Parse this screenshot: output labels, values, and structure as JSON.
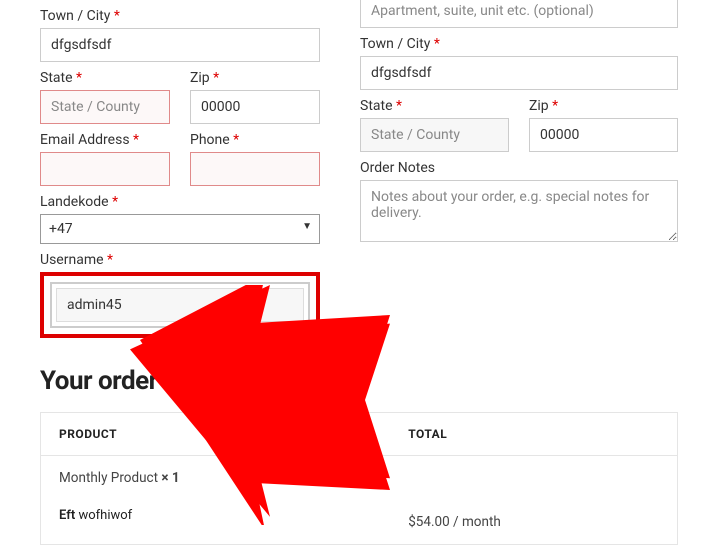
{
  "left": {
    "town_city": {
      "label": "Town / City",
      "value": "dfgsdfsdf"
    },
    "state": {
      "label": "State",
      "placeholder": "State / County",
      "value": ""
    },
    "zip": {
      "label": "Zip",
      "value": "00000"
    },
    "email": {
      "label": "Email Address",
      "value": ""
    },
    "phone": {
      "label": "Phone",
      "value": ""
    },
    "landekode": {
      "label": "Landekode",
      "value": "+47"
    },
    "username": {
      "label": "Username",
      "value": "admin45"
    }
  },
  "right": {
    "apartment": {
      "placeholder": "Apartment, suite, unit etc. (optional)",
      "value": ""
    },
    "town_city": {
      "label": "Town / City",
      "value": "dfgsdfsdf"
    },
    "state": {
      "label": "State",
      "placeholder": "State / County",
      "value": ""
    },
    "zip": {
      "label": "Zip",
      "value": "00000"
    },
    "order_notes": {
      "label": "Order Notes",
      "placeholder": "Notes about your order, e.g. special notes for delivery.",
      "value": ""
    }
  },
  "order": {
    "heading": "Your order",
    "cols": {
      "product": "PRODUCT",
      "total": "TOTAL"
    },
    "line1": {
      "name": "Monthly Product",
      "qty": "× 1"
    },
    "line2_prefix": "Eft",
    "line2_rest": "wofhiwof",
    "price": "$54.00 / month"
  }
}
